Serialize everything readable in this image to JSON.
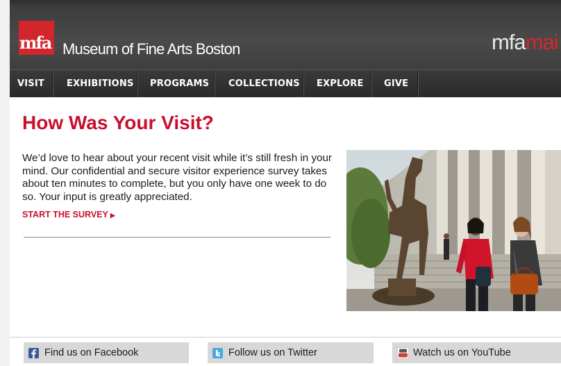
{
  "header": {
    "logo_text": "mfa",
    "museum_name_bold": "Museum of Fine Arts",
    "museum_name_light": "Boston",
    "brand_left": "mfa",
    "brand_right": "mai"
  },
  "nav": {
    "items": [
      "VISIT",
      "EXHIBITIONS",
      "PROGRAMS",
      "COLLECTIONS",
      "EXPLORE",
      "GIVE"
    ]
  },
  "main": {
    "title": "How Was Your Visit?",
    "body": "We’d love to hear about your recent visit while it’s still fresh in your mind. Our confidential and secure visitor experience survey takes about ten minutes to complete, but you only have one week to do so. Your input is greatly appreciated.",
    "cta_label": "START THE SURVEY",
    "cta_arrow": "▶"
  },
  "footer": {
    "facebook": "Find us on Facebook",
    "twitter": "Follow us on Twitter",
    "youtube": "Watch us on YouTube"
  },
  "colors": {
    "accent_red": "#c8102e",
    "header_gray": "#444444",
    "nav_dark": "#2e2e2e",
    "facebook_blue": "#3b5998",
    "twitter_blue": "#4aa8e0",
    "youtube_red": "#d33f3a"
  }
}
